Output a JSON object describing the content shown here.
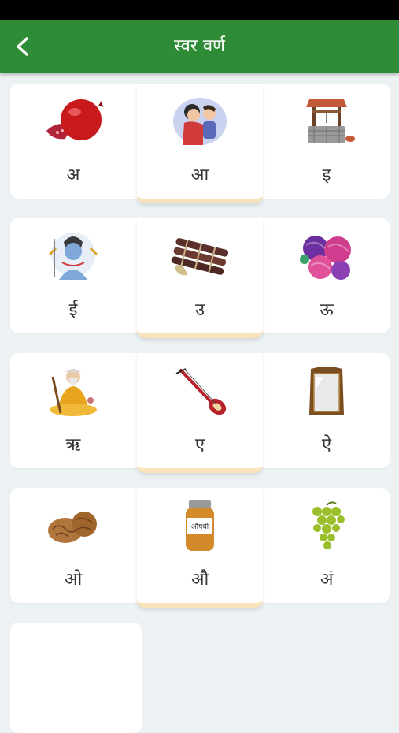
{
  "header": {
    "title": "स्वर वर्ण"
  },
  "rows": [
    {
      "cells": [
        {
          "letter": "अ",
          "icon": "pomegranate-icon"
        },
        {
          "letter": "आ",
          "icon": "mother-child-icon"
        },
        {
          "letter": "इ",
          "icon": "well-icon"
        }
      ]
    },
    {
      "cells": [
        {
          "letter": "ई",
          "icon": "shiva-icon"
        },
        {
          "letter": "उ",
          "icon": "sugarcane-icon"
        },
        {
          "letter": "ऊ",
          "icon": "wool-balls-icon"
        }
      ]
    },
    {
      "cells": [
        {
          "letter": "ऋ",
          "icon": "sage-icon"
        },
        {
          "letter": "ए",
          "icon": "ektara-icon"
        },
        {
          "letter": "ऐ",
          "icon": "mirror-icon"
        }
      ]
    },
    {
      "cells": [
        {
          "letter": "ओ",
          "icon": "walnut-icon"
        },
        {
          "letter": "औ",
          "icon": "medicine-bottle-icon",
          "icon_text": "औषधी"
        },
        {
          "letter": "अं",
          "icon": "grapes-icon"
        }
      ]
    }
  ]
}
